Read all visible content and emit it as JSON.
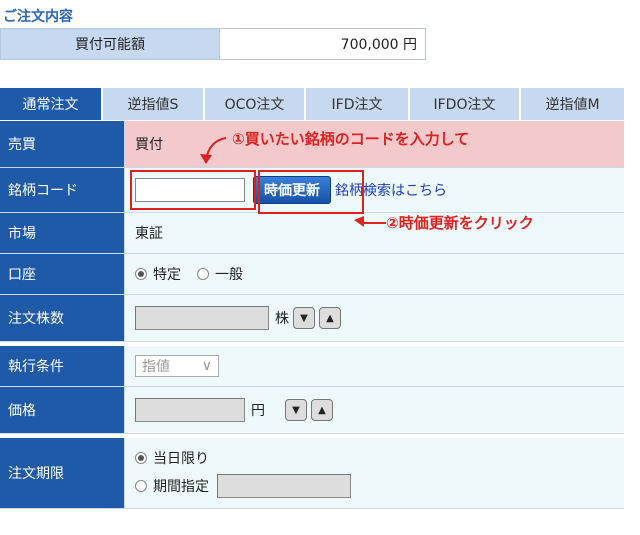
{
  "section_title": "ご注文内容",
  "buying_power": {
    "label": "買付可能額",
    "value": "700,000 円"
  },
  "tabs": [
    {
      "label": "通常注文",
      "active": true
    },
    {
      "label": "逆指値S",
      "active": false
    },
    {
      "label": "OCO注文",
      "active": false
    },
    {
      "label": "IFD注文",
      "active": false
    },
    {
      "label": "IFDO注文",
      "active": false
    },
    {
      "label": "逆指値M",
      "active": false
    }
  ],
  "form": {
    "side": {
      "label": "売買",
      "value": "買付"
    },
    "code": {
      "label": "銘柄コード",
      "button": "時価更新",
      "link": "銘柄検索はこちら",
      "value": ""
    },
    "market": {
      "label": "市場",
      "value": "東証"
    },
    "account": {
      "label": "口座",
      "options": [
        "特定",
        "一般"
      ],
      "selected": "特定"
    },
    "qty": {
      "label": "注文株数",
      "unit": "株"
    },
    "condition": {
      "label": "執行条件",
      "value": "指値"
    },
    "price": {
      "label": "価格",
      "unit": "円"
    },
    "expiry": {
      "label": "注文期限",
      "options": [
        "当日限り",
        "期間指定"
      ],
      "selected": "当日限り"
    }
  },
  "annotations": {
    "step1": "①買いたい銘柄のコードを入力して",
    "step2": "②時価更新をクリック"
  },
  "colors": {
    "accent": "#1f5aa8",
    "tab_inactive": "#c6d9f1",
    "annotation": "#dd2222"
  }
}
